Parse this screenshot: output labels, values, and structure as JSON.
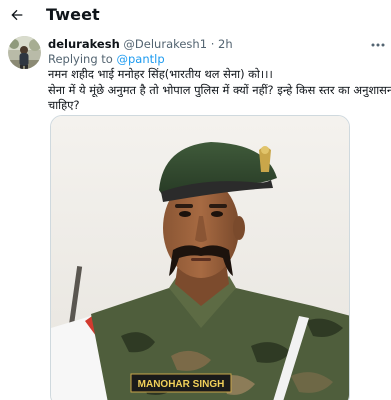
{
  "header": {
    "back_icon": "arrow-left-icon",
    "title": "Tweet"
  },
  "tweet": {
    "author_name": "delurakesh",
    "author_handle": "@Delurakesh1",
    "separator": "·",
    "time": "2h",
    "more_icon": "more-horizontal-icon",
    "replying_prefix": "Replying to",
    "replying_handle": "@pantlp",
    "text_lines": [
      "नमन शहीद भाई मनोहर सिंह(भारतीय थल सेना) को।।।",
      "सेना में ये मूंछे अनुमत है तो भोपाल पुलिस में क्यों नहीं? इन्हे किस स्तर का अनुशासन",
      "चाहिए?"
    ],
    "media": {
      "name_tag": "MANOHAR SINGH"
    }
  },
  "colors": {
    "accent": "#1d9bf0",
    "text": "#0f1419",
    "muted": "#536471",
    "border": "#cfd9de"
  }
}
